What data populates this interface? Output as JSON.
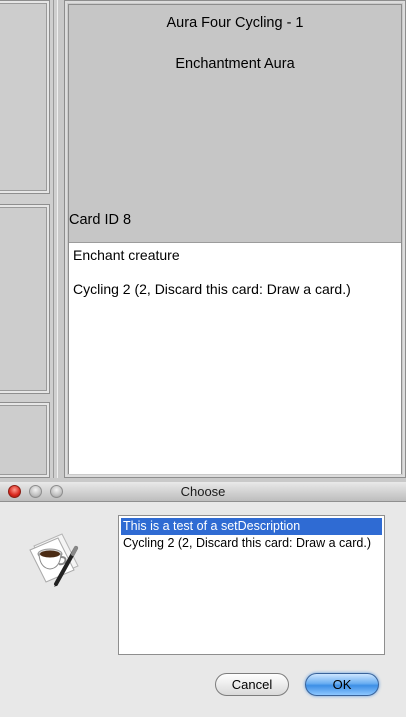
{
  "card": {
    "title": "Aura Four Cycling  - 1",
    "type_line": "Enchantment Aura",
    "card_id": "Card ID  8",
    "rules_text": [
      "Enchant creature",
      "Cycling 2 (2, Discard this card: Draw a card.)"
    ]
  },
  "dialog": {
    "title": "Choose",
    "icon": "coffee-cup-pen-icon",
    "options": [
      "This is a test of a setDescription",
      "Cycling 2 (2, Discard this card: Draw a card.)"
    ],
    "selected_index": 0,
    "cancel_label": "Cancel",
    "ok_label": "OK",
    "colors": {
      "selection": "#2f6bd3",
      "default_button": "#3d8fe6",
      "close_button": "#d8261c"
    }
  }
}
